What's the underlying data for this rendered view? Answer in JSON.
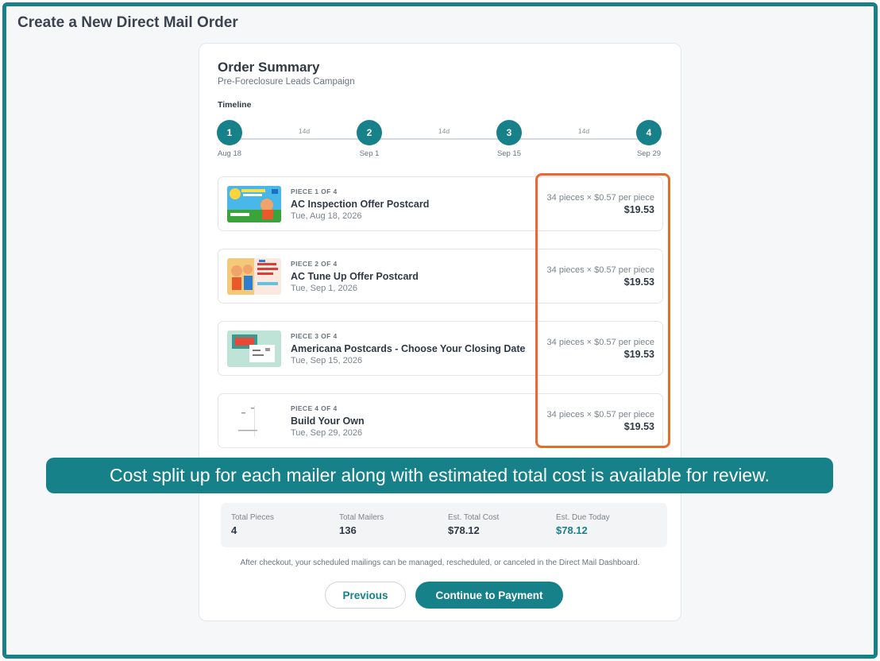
{
  "page": {
    "title": "Create a New Direct Mail Order"
  },
  "summary": {
    "title": "Order Summary",
    "subtitle": "Pre-Foreclosure Leads Campaign",
    "timeline_label": "Timeline",
    "timeline": [
      {
        "step": "1",
        "date": "Aug 18"
      },
      {
        "step": "2",
        "date": "Sep 1"
      },
      {
        "step": "3",
        "date": "Sep 15"
      },
      {
        "step": "4",
        "date": "Sep 29"
      }
    ],
    "gaps": [
      "14d",
      "14d",
      "14d"
    ]
  },
  "pieces": [
    {
      "number": "PIECE 1 OF 4",
      "name": "AC Inspection Offer Postcard",
      "date": "Tue, Aug 18, 2026",
      "rate": "34 pieces × $0.57 per piece",
      "price": "$19.53"
    },
    {
      "number": "PIECE 2 OF 4",
      "name": "AC Tune Up Offer Postcard",
      "date": "Tue, Sep 1, 2026",
      "rate": "34 pieces × $0.57 per piece",
      "price": "$19.53"
    },
    {
      "number": "PIECE 3 OF 4",
      "name": "Americana Postcards - Choose Your Closing Date",
      "date": "Tue, Sep 15, 2026",
      "rate": "34 pieces × $0.57 per piece",
      "price": "$19.53"
    },
    {
      "number": "PIECE 4 OF 4",
      "name": "Build Your Own",
      "date": "Tue, Sep 29, 2026",
      "rate": "34 pieces × $0.57 per piece",
      "price": "$19.53"
    }
  ],
  "callout": "Cost split up for each mailer along with estimated total cost is available for review.",
  "totals": [
    {
      "label": "Total Pieces",
      "value": "4"
    },
    {
      "label": "Total Mailers",
      "value": "136"
    },
    {
      "label": "Est. Total Cost",
      "value": "$78.12"
    },
    {
      "label": "Est. Due Today",
      "value": "$78.12"
    }
  ],
  "footnote": "After checkout, your scheduled mailings can be managed, rescheduled, or canceled in the Direct Mail Dashboard.",
  "buttons": {
    "previous": "Previous",
    "continue": "Continue to Payment"
  },
  "colors": {
    "accent": "#17818a",
    "highlight": "#ea6a2c"
  }
}
